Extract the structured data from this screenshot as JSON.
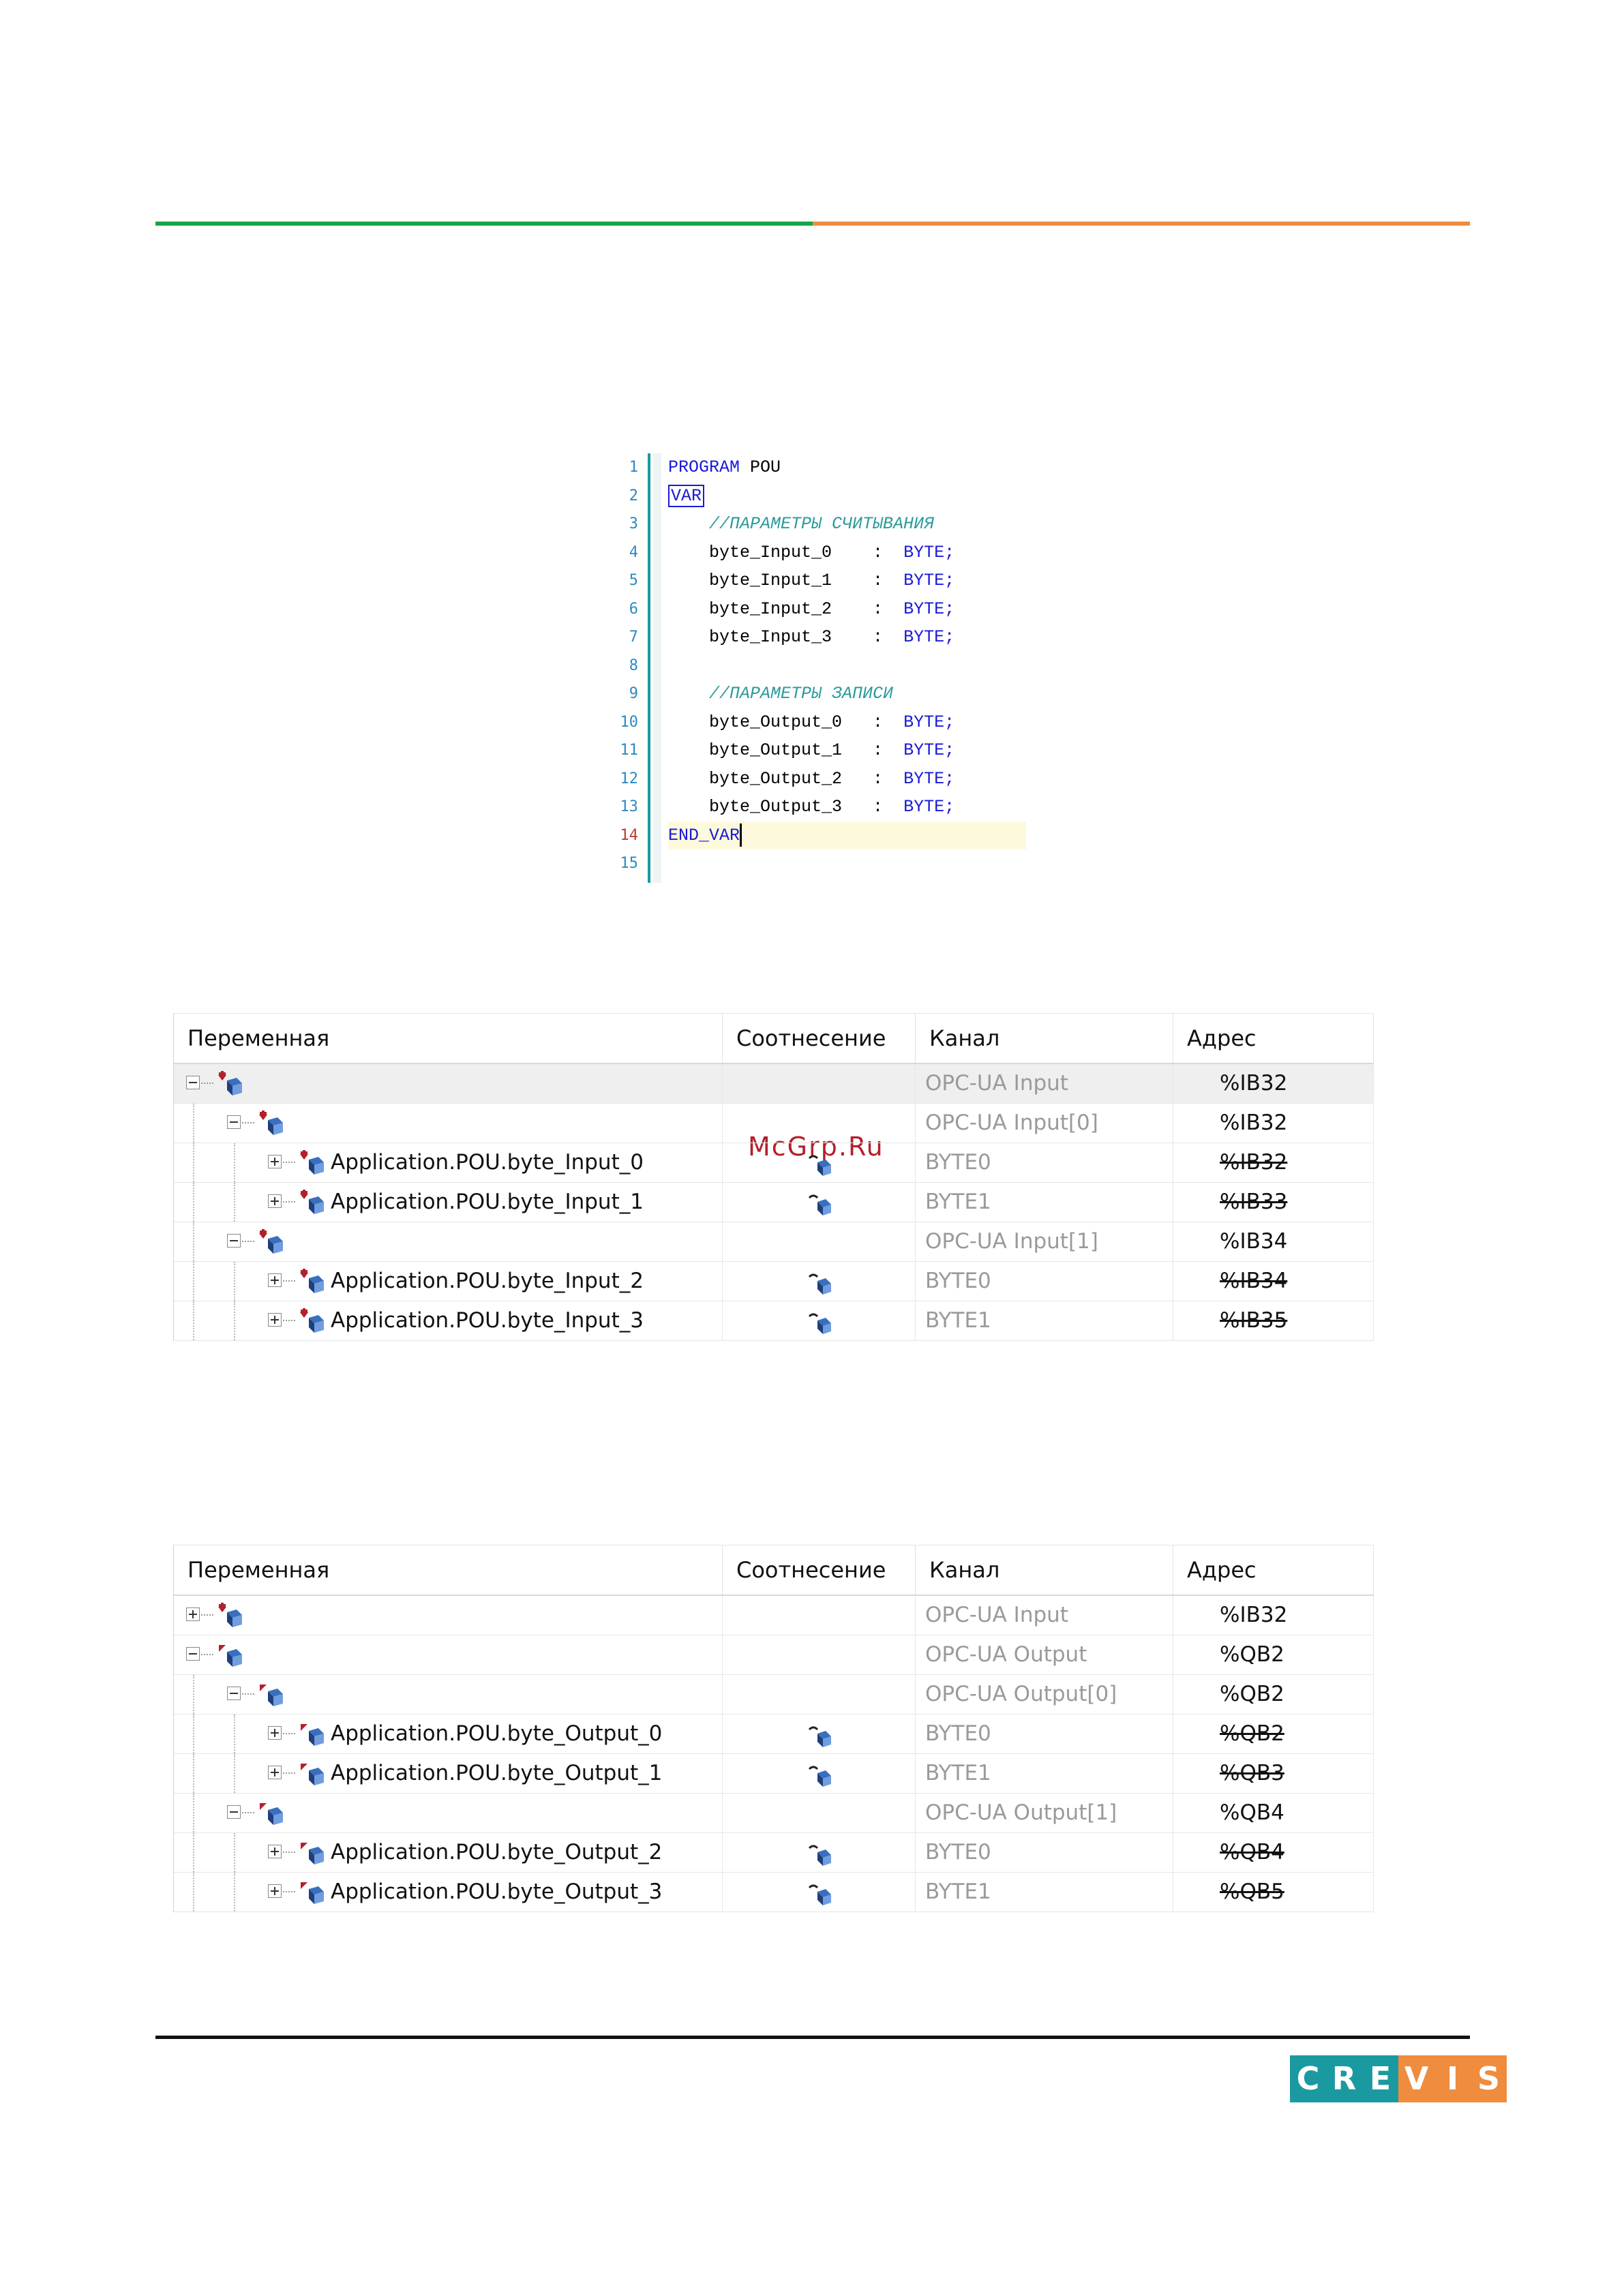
{
  "code": {
    "line_numbers": [
      "1",
      "2",
      "3",
      "4",
      "5",
      "6",
      "7",
      "8",
      "9",
      "10",
      "11",
      "12",
      "13",
      "14",
      "15"
    ],
    "program_kw": "PROGRAM",
    "program_name": " POU",
    "var_kw": "VAR",
    "comment_read": "//ПАРАМЕТРЫ СЧИТЫВАНИЯ",
    "comment_write": "//ПАРАМЕТРЫ ЗАПИСИ",
    "decls_in": [
      "byte_Input_0    :  ",
      "byte_Input_1    :  ",
      "byte_Input_2    :  ",
      "byte_Input_3    :  "
    ],
    "decls_out": [
      "byte_Output_0   :  ",
      "byte_Output_1   :  ",
      "byte_Output_2   :  ",
      "byte_Output_3   :  "
    ],
    "type_kw": "BYTE;",
    "end_kw_a": "END_VA",
    "end_kw_b": "R"
  },
  "watermark": "McGrp.Ru",
  "table_headers": {
    "variable": "Переменная",
    "mapping": "Соотнесение",
    "channel": "Канал",
    "address": "Адрес"
  },
  "input_table": {
    "rows": [
      {
        "name": "",
        "channel": "OPC-UA Input",
        "address": "%IB32"
      },
      {
        "name": "",
        "channel": "OPC-UA Input[0]",
        "address": "%IB32"
      },
      {
        "name": "Application.POU.byte_Input_0",
        "channel": "BYTE0",
        "address": "%IB32"
      },
      {
        "name": "Application.POU.byte_Input_1",
        "channel": "BYTE1",
        "address": "%IB33"
      },
      {
        "name": "",
        "channel": "OPC-UA Input[1]",
        "address": "%IB34"
      },
      {
        "name": "Application.POU.byte_Input_2",
        "channel": "BYTE0",
        "address": "%IB34"
      },
      {
        "name": "Application.POU.byte_Input_3",
        "channel": "BYTE1",
        "address": "%IB35"
      }
    ]
  },
  "output_table": {
    "rows": [
      {
        "name": "",
        "channel": "OPC-UA Input",
        "address": "%IB32"
      },
      {
        "name": "",
        "channel": "OPC-UA Output",
        "address": "%QB2"
      },
      {
        "name": "",
        "channel": "OPC-UA Output[0]",
        "address": "%QB2"
      },
      {
        "name": "Application.POU.byte_Output_0",
        "channel": "BYTE0",
        "address": "%QB2"
      },
      {
        "name": "Application.POU.byte_Output_1",
        "channel": "BYTE1",
        "address": "%QB3"
      },
      {
        "name": "",
        "channel": "OPC-UA Output[1]",
        "address": "%QB4"
      },
      {
        "name": "Application.POU.byte_Output_2",
        "channel": "BYTE0",
        "address": "%QB4"
      },
      {
        "name": "Application.POU.byte_Output_3",
        "channel": "BYTE1",
        "address": "%QB5"
      }
    ]
  },
  "logo": {
    "letters": [
      "C",
      "R",
      "E",
      "V",
      "I",
      "S"
    ]
  },
  "colors": {
    "green": "#1aa24a",
    "orange": "#ef8c3d",
    "teal": "#1a9aa0",
    "keyword": "#1a1ad8",
    "comment": "#2b9a9a"
  }
}
